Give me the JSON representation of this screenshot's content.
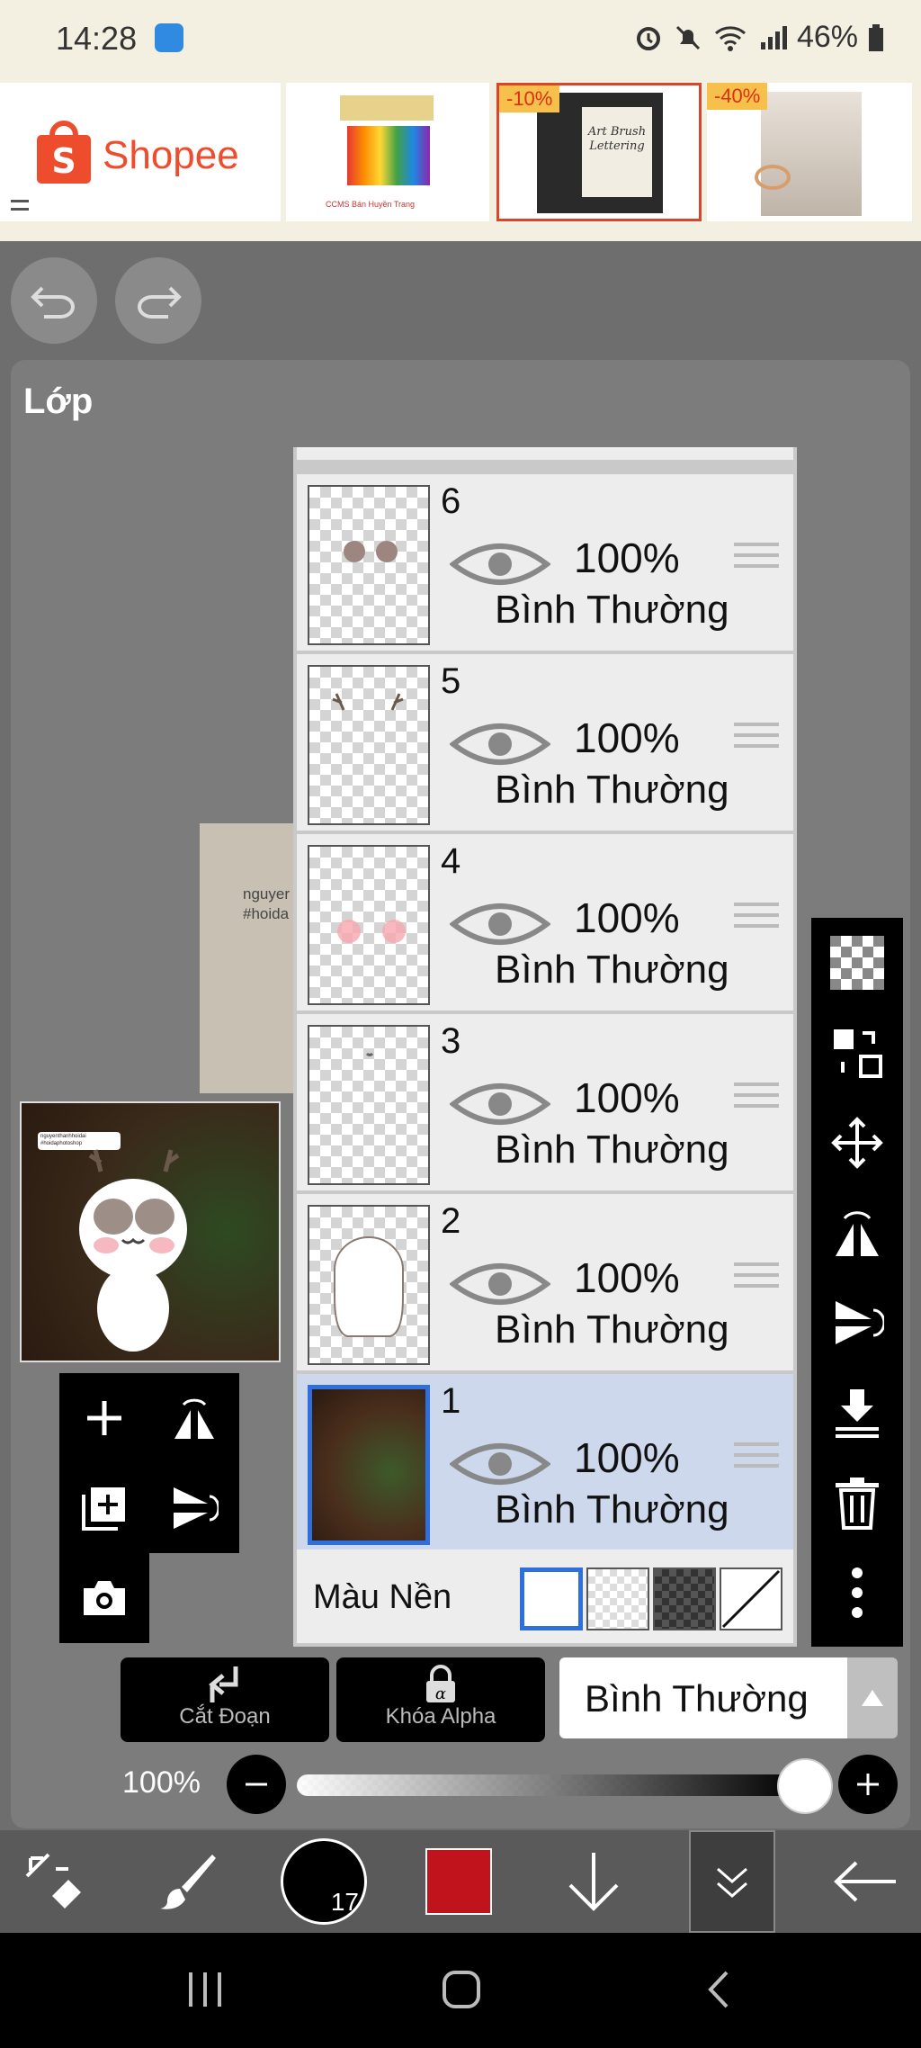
{
  "status_bar": {
    "time": "14:28",
    "battery": "46%",
    "icons": [
      "app-notification-icon",
      "alarm-icon",
      "mute-icon",
      "wifi-icon",
      "signal-icon",
      "battery-icon"
    ]
  },
  "ad_banner": {
    "brand": "Shopee",
    "items": [
      {
        "name": "markers-product",
        "badge": "",
        "caption": "CCMS Bán Huyền Trang"
      },
      {
        "name": "lettering-book",
        "badge": "-10%",
        "caption": "Art Brush Lettering"
      },
      {
        "name": "rings-product",
        "badge": "-40%",
        "caption": ""
      }
    ],
    "accent": "#ee4d2d"
  },
  "topbar": {
    "undo_icon": "undo-icon",
    "redo_icon": "redo-icon"
  },
  "panel": {
    "title": "Lớp"
  },
  "canvas_preview": {
    "text_line1": "nguyer",
    "text_line2": "#hoida"
  },
  "thumb_preview": {
    "sticker_text": "nguyenthanhhoidai #hoidaphotoshop"
  },
  "layers": [
    {
      "number": "6",
      "opacity": "100%",
      "mode": "Bình Thường",
      "selected": false
    },
    {
      "number": "5",
      "opacity": "100%",
      "mode": "Bình Thường",
      "selected": false
    },
    {
      "number": "4",
      "opacity": "100%",
      "mode": "Bình Thường",
      "selected": false
    },
    {
      "number": "3",
      "opacity": "100%",
      "mode": "Bình Thường",
      "selected": false
    },
    {
      "number": "2",
      "opacity": "100%",
      "mode": "Bình Thường",
      "selected": false
    },
    {
      "number": "1",
      "opacity": "100%",
      "mode": "Bình Thường",
      "selected": true
    }
  ],
  "background_row": {
    "label": "Màu Nền",
    "selected_swatch": "white"
  },
  "right_tools": [
    "checker-icon",
    "transfer-icon",
    "move-icon",
    "flip-horizontal-icon",
    "flip-vertical-icon",
    "merge-down-icon",
    "trash-icon",
    "more-icon"
  ],
  "left_tools": [
    "add-layer-icon",
    "flip-layer-icon",
    "duplicate-layer-icon",
    "rotate-layer-icon",
    "camera-icon"
  ],
  "actions": {
    "clip_label": "Cắt Đoạn",
    "alpha_lock_label": "Khóa Alpha",
    "blend_mode": "Bình Thường"
  },
  "opacity": {
    "label": "100%",
    "value": 1.0
  },
  "bottom_bar": {
    "brush_size": "17",
    "color": "#c0131b"
  },
  "colors": {
    "selection": "#2f6fdc",
    "panel": "#7c7c7c"
  }
}
